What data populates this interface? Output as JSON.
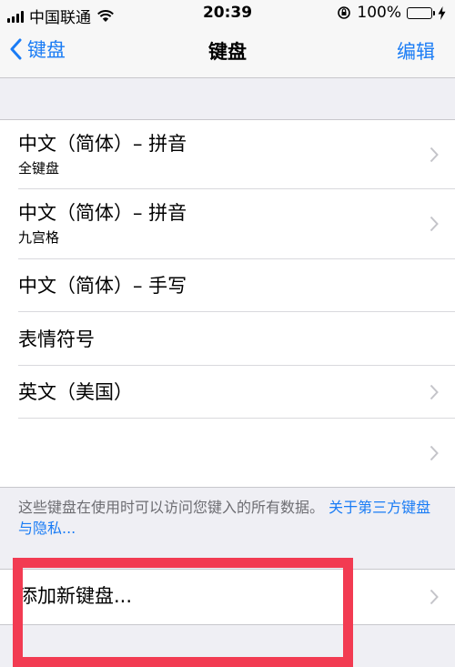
{
  "status_bar": {
    "carrier": "中国联通",
    "time": "20:39",
    "battery": "100%"
  },
  "nav": {
    "back_label": "键盘",
    "title": "键盘",
    "edit_label": "编辑"
  },
  "keyboards": [
    {
      "title": "中文（简体）– 拼音",
      "subtitle": "全键盘",
      "chevron": true
    },
    {
      "title": "中文（简体）– 拼音",
      "subtitle": "九宫格",
      "chevron": true
    },
    {
      "title": "中文（简体）– 手写",
      "chevron": false
    },
    {
      "title": "表情符号",
      "chevron": false
    },
    {
      "title": "英文（美国）",
      "chevron": true
    },
    {
      "title": "",
      "chevron": true
    }
  ],
  "footer": {
    "text": "这些键盘在使用时可以访问您键入的所有数据。",
    "link": "关于第三方键盘与隐私..."
  },
  "add_keyboard": {
    "label": "添加新键盘..."
  },
  "colors": {
    "accent": "#1a7cf5",
    "highlight": "#f23b52",
    "battery": "#4cd964"
  }
}
